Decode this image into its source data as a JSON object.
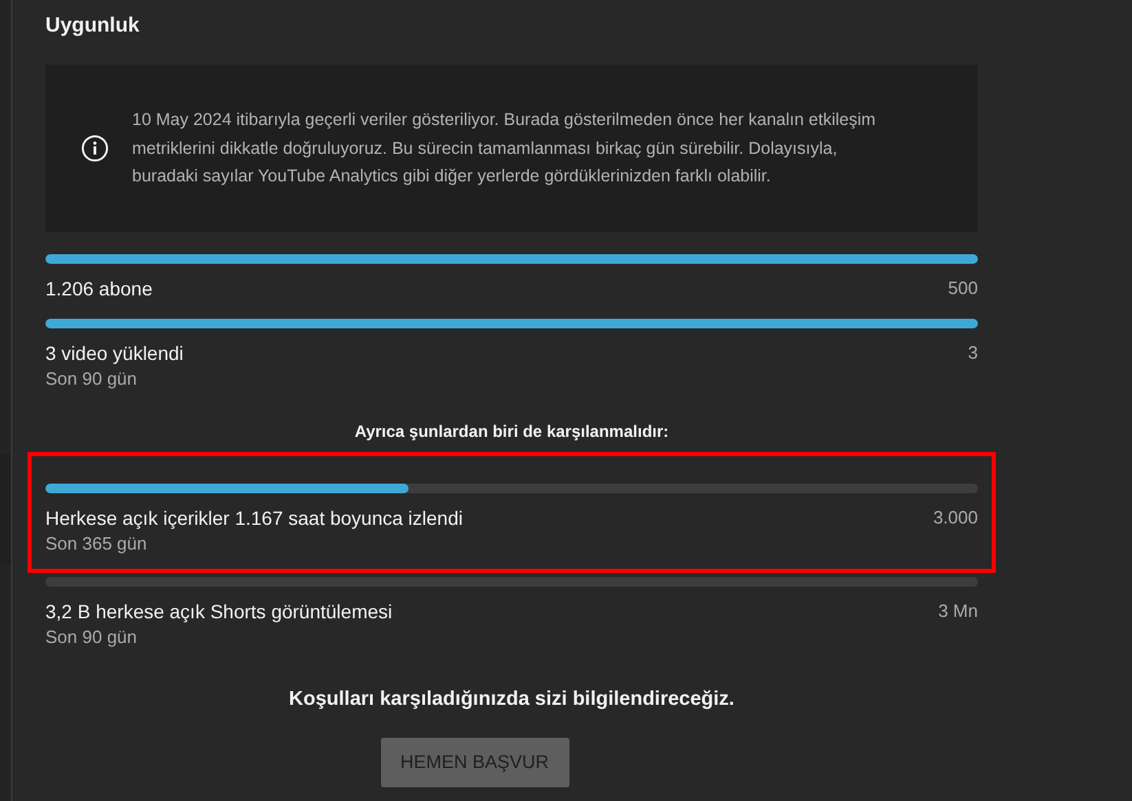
{
  "section_title": "Uygunluk",
  "notice": {
    "text": "10 May 2024 itibarıyla geçerli veriler gösteriliyor. Burada gösterilmeden önce her kanalın etkileşim metriklerini dikkatle doğruluyoruz. Bu sürecin tamamlanması birkaç gün sürebilir. Dolayısıyla, buradaki sayılar YouTube Analytics gibi diğer yerlerde gördüklerinizden farklı olabilir."
  },
  "required_metrics": [
    {
      "label": "1.206 abone",
      "target": "500",
      "level": 1,
      "highlighted": false
    },
    {
      "label": "3 video yüklendi",
      "period": "Son 90 gün",
      "target": "3",
      "level": 1,
      "highlighted": false
    }
  ],
  "alternative_heading": "Ayrıca şunlardan biri de karşılanmalıdır:",
  "alternative_metrics": [
    {
      "label": "Herkese açık içerikler 1.167 saat boyunca izlendi",
      "period": "Son 365 gün",
      "target": "3.000",
      "level": 0.389,
      "highlighted": true
    },
    {
      "label": "3,2 B herkese açık Shorts görüntülemesi",
      "period": "Son 90 gün",
      "target": "3 Mn",
      "level": 0,
      "highlighted": false
    }
  ],
  "footer_message": "Koşulları karşıladığınızda sizi bilgilendireceğiz.",
  "apply_button": {
    "label": "HEMEN BAŞVUR",
    "disabled": true
  }
}
